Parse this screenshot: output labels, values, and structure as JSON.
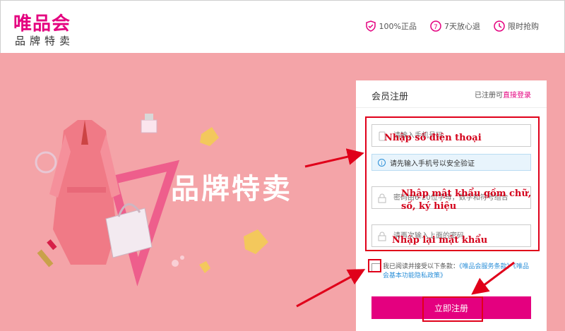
{
  "header": {
    "logo_title": "唯品会",
    "logo_subtitle": "品牌特卖",
    "promises": [
      {
        "icon": "shield-check-icon",
        "label": "100%正品"
      },
      {
        "icon": "return-7-icon",
        "label": "7天放心退"
      },
      {
        "icon": "clock-icon",
        "label": "限时抢购"
      }
    ]
  },
  "banner": {
    "brand_text": "品牌特卖"
  },
  "form": {
    "title": "会员注册",
    "login_prompt": "已注册可",
    "login_link": "直接登录",
    "phone_placeholder": "请输入手机号码",
    "info_text": "请先输入手机号以安全验证",
    "password_placeholder": "密码由6-20位字母，数字和符号组合",
    "confirm_placeholder": "请再次输入上面的密码",
    "agree_text": "我已阅读并接受以下条款：",
    "terms_link": "《唯品会服务条款》",
    "privacy_link": "《唯品会基本功能隐私政策》",
    "submit_label": "立即注册"
  },
  "annotations": {
    "phone": "Nhập số điện thoại",
    "password_line1": "Nhập mật khẩu gồm chữ,",
    "password_line2": "số, ký hiệu",
    "confirm": "Nhập lại mật khẩu"
  },
  "colors": {
    "brand": "#e4007f",
    "banner_bg": "#f4a4a8",
    "annotation": "#e0001a",
    "link": "#2b8fd8"
  }
}
